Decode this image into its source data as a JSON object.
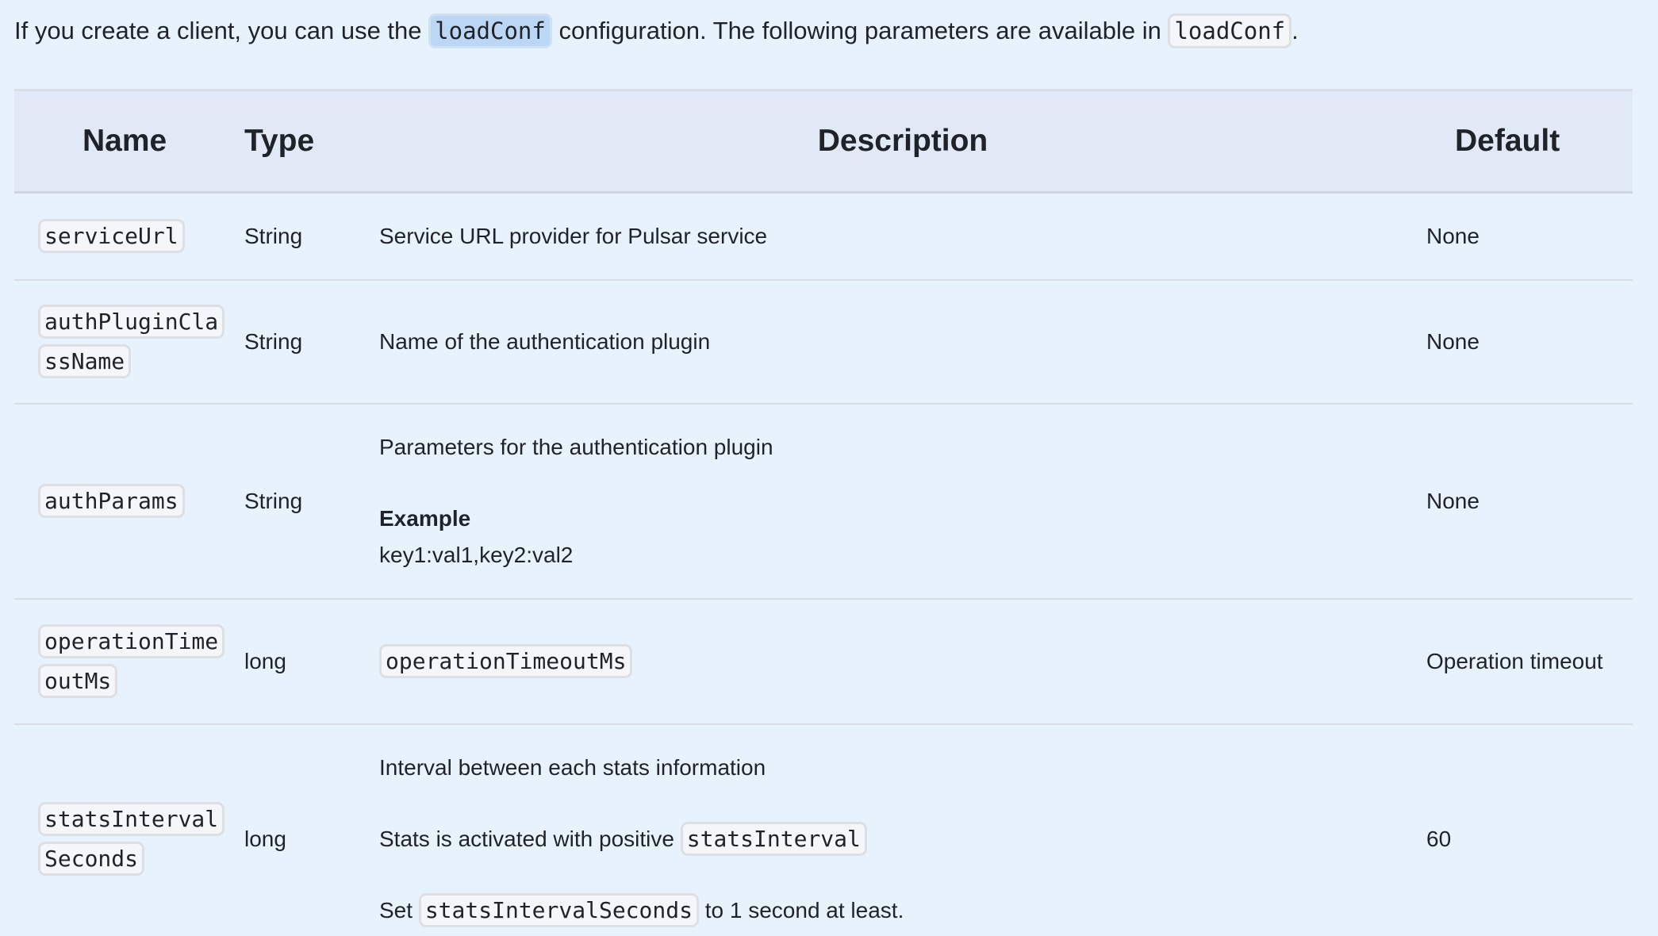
{
  "intro": {
    "before": "If you create a client, you can use the ",
    "code1": "loadConf",
    "middle": " configuration. The following parameters are available in ",
    "code2": "loadConf",
    "after": "."
  },
  "table": {
    "headers": {
      "name": "Name",
      "type": "Type",
      "description": "Description",
      "default": "Default"
    },
    "rows": [
      {
        "name": "serviceUrl",
        "type": "String",
        "description": "Service URL provider for Pulsar service",
        "default": "None"
      },
      {
        "name": "authPluginClassName",
        "type": "String",
        "description": "Name of the authentication plugin",
        "default": "None"
      },
      {
        "name": "authParams",
        "type": "String",
        "description": "Parameters for the authentication plugin",
        "example_label": "Example",
        "example_value": "key1:val1,key2:val2",
        "default": "None"
      },
      {
        "name": "operationTimeoutMs",
        "type": "long",
        "description_code": "operationTimeoutMs",
        "default": "Operation timeout"
      },
      {
        "name": "statsIntervalSeconds",
        "type": "long",
        "description": "Interval between each stats information",
        "line2_text": "Stats is activated with positive ",
        "line2_code": "statsInterval",
        "line3_before": "Set ",
        "line3_code": "statsIntervalSeconds",
        "line3_after": " to 1 second at least.",
        "default": "60"
      }
    ]
  }
}
